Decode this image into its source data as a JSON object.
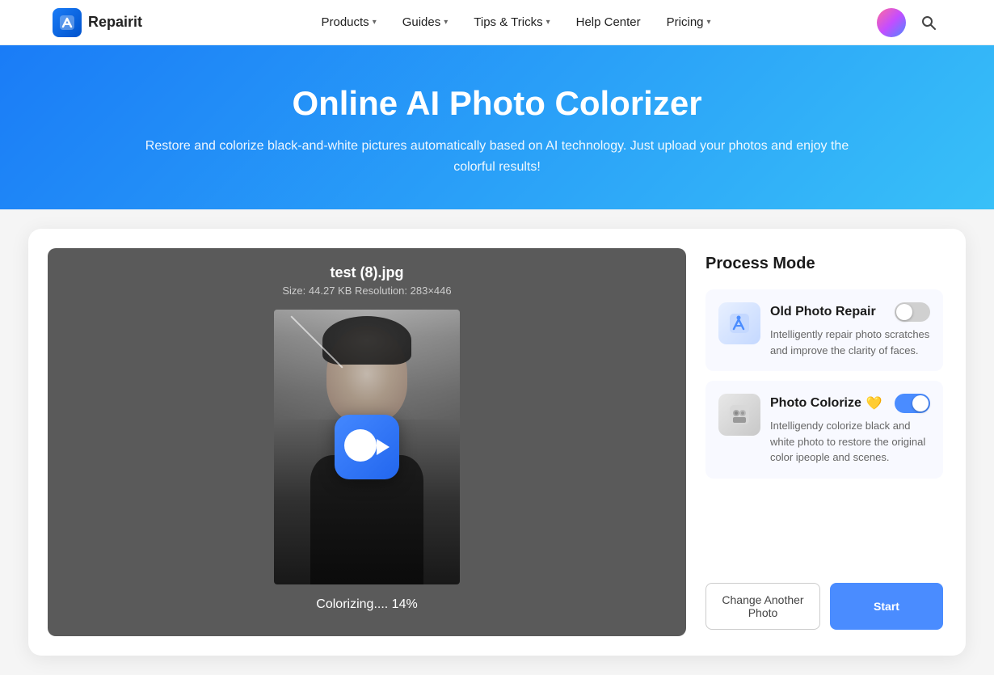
{
  "navbar": {
    "logo_text": "Repairit",
    "items": [
      {
        "label": "Products",
        "has_dropdown": true
      },
      {
        "label": "Guides",
        "has_dropdown": true
      },
      {
        "label": "Tips & Tricks",
        "has_dropdown": true
      },
      {
        "label": "Help Center",
        "has_dropdown": false
      },
      {
        "label": "Pricing",
        "has_dropdown": true
      }
    ]
  },
  "hero": {
    "title": "Online AI Photo Colorizer",
    "subtitle": "Restore and colorize black-and-white pictures automatically based on AI technology. Just upload your photos and enjoy the colorful results!"
  },
  "file_panel": {
    "filename": "test (8).jpg",
    "meta": "Size: 44.27 KB  Resolution: 283×446",
    "progress_text": "Colorizing.... 14%"
  },
  "process_mode": {
    "title": "Process Mode",
    "modes": [
      {
        "name": "Old Photo Repair",
        "badge": "",
        "description": "Intelligently repair photo scratches and improve the clarity of faces.",
        "toggle_on": false
      },
      {
        "name": "Photo Colorize",
        "badge": "💛",
        "description": "Intelligendy colorize black and white photo to restore the original color ipeople and scenes.",
        "toggle_on": true
      }
    ]
  },
  "buttons": {
    "change_label": "Change Another Photo",
    "start_label": "Start"
  }
}
